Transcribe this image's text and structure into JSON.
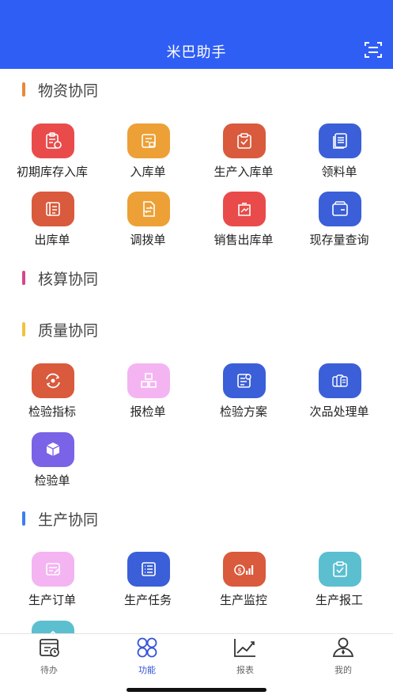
{
  "header": {
    "title": "米巴助手",
    "scan_icon": "scan-icon"
  },
  "sections": [
    {
      "title": "物资协同",
      "color": "#e8883a"
    },
    {
      "title": "核算协同",
      "color": "#d6478c"
    },
    {
      "title": "质量协同",
      "color": "#f2c23c"
    },
    {
      "title": "生产协同",
      "color": "#3f7cf0"
    }
  ],
  "materials": [
    {
      "label": "初期库存入库",
      "icon": "clipboard-in-icon",
      "color": "#e94b4b"
    },
    {
      "label": "入库单",
      "icon": "doc-in-icon",
      "color": "#eda035"
    },
    {
      "label": "生产入库单",
      "icon": "clipboard-check-icon",
      "color": "#d95a3c"
    },
    {
      "label": "领料单",
      "icon": "stack-doc-icon",
      "color": "#3a5fd8"
    },
    {
      "label": "出库单",
      "icon": "doc-out-icon",
      "color": "#d95a3c"
    },
    {
      "label": "调拨单",
      "icon": "transfer-doc-icon",
      "color": "#eda035"
    },
    {
      "label": "销售出库单",
      "icon": "sale-doc-icon",
      "color": "#e94b4b"
    },
    {
      "label": "现存量查询",
      "icon": "wallet-icon",
      "color": "#3a5fd8"
    }
  ],
  "quality": [
    {
      "label": "检验指标",
      "icon": "refresh-gear-icon",
      "color": "#d95a3c"
    },
    {
      "label": "报检单",
      "icon": "boxes-icon",
      "color": "#f4b4f2"
    },
    {
      "label": "检验方案",
      "icon": "list-search-icon",
      "color": "#3a5fd8"
    },
    {
      "label": "次品处理单",
      "icon": "coins-stack-icon",
      "color": "#3a5fd8"
    },
    {
      "label": "检验单",
      "icon": "cube-icon",
      "color": "#7a63e6"
    }
  ],
  "production": [
    {
      "label": "生产订单",
      "icon": "order-edit-icon",
      "color": "#f4b4f2"
    },
    {
      "label": "生产任务",
      "icon": "task-list-icon",
      "color": "#3a5fd8"
    },
    {
      "label": "生产监控",
      "icon": "money-chart-icon",
      "color": "#d95a3c"
    },
    {
      "label": "生产报工",
      "icon": "clipboard-check-icon",
      "color": "#5bbfd0"
    }
  ],
  "tabs": [
    {
      "label": "待办",
      "icon": "todo-calendar-icon",
      "active": false
    },
    {
      "label": "功能",
      "icon": "grid-circles-icon",
      "active": true
    },
    {
      "label": "报表",
      "icon": "trend-chart-icon",
      "active": false
    },
    {
      "label": "我的",
      "icon": "user-icon",
      "active": false
    }
  ]
}
